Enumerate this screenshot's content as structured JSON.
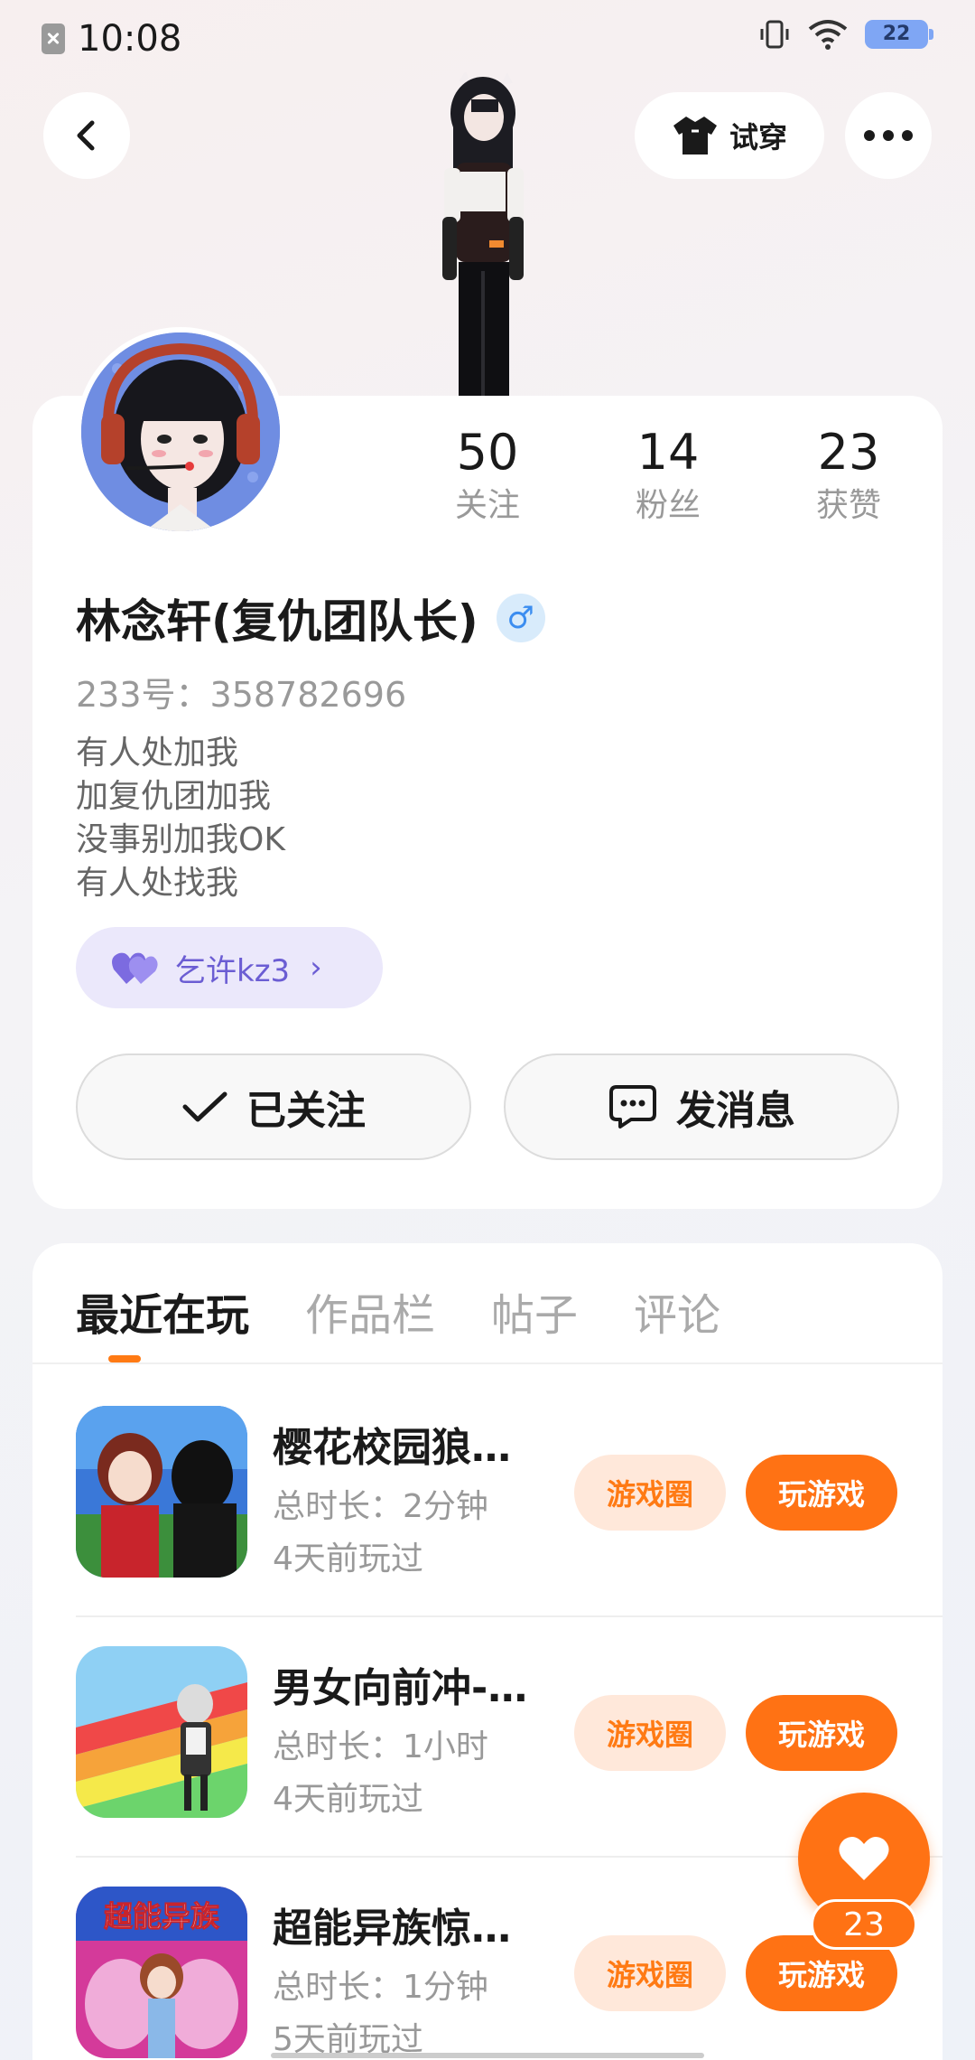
{
  "status_bar": {
    "time": "10:08",
    "battery": "22"
  },
  "header": {
    "tryon_label": "试穿"
  },
  "profile": {
    "stats": [
      {
        "value": "50",
        "label": "关注"
      },
      {
        "value": "14",
        "label": "粉丝"
      },
      {
        "value": "23",
        "label": "获赞"
      }
    ],
    "name": "林念轩(复仇团队长)",
    "gender_symbol": "♂",
    "id_text": "233号：358782696",
    "bio": [
      "有人处加我",
      "加复仇团加我",
      "没事别加我OK",
      "有人处找我"
    ],
    "tag": {
      "label": "乞许kz3"
    },
    "follow_label": "已关注",
    "message_label": "发消息"
  },
  "tabs": [
    "最近在玩",
    "作品栏",
    "帖子",
    "评论"
  ],
  "games": [
    {
      "name": "樱花校园狼…",
      "duration": "总时长：2分钟",
      "last_played": "4天前玩过",
      "circle_label": "游戏圈",
      "play_label": "玩游戏"
    },
    {
      "name": "男女向前冲-…",
      "duration": "总时长：1小时",
      "last_played": "4天前玩过",
      "circle_label": "游戏圈",
      "play_label": "玩游戏"
    },
    {
      "name": "超能异族惊…",
      "duration": "总时长：1分钟",
      "last_played": "5天前玩过",
      "circle_label": "游戏圈",
      "play_label": "玩游戏",
      "icon_text": "超能异族"
    }
  ],
  "like_fab": {
    "count": "23"
  },
  "colors": {
    "accent": "#ff7214",
    "accent_light": "#ffe8da",
    "tag_bg": "#ebe8fb",
    "tag_text": "#6b5dd3"
  }
}
